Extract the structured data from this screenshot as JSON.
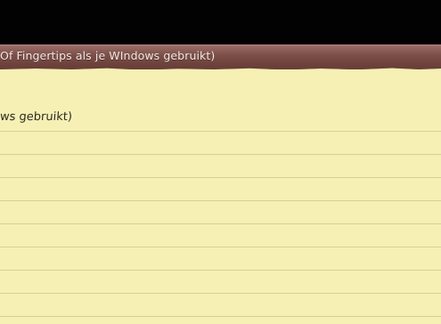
{
  "window": {
    "title": "Of Fingertips als je WIndows gebruikt)"
  },
  "note": {
    "first_line": "ws gebruikt)"
  },
  "colors": {
    "title_bar": "#7c4f48",
    "paper": "#f6f0b4",
    "rule_line": "#d8cf95"
  }
}
